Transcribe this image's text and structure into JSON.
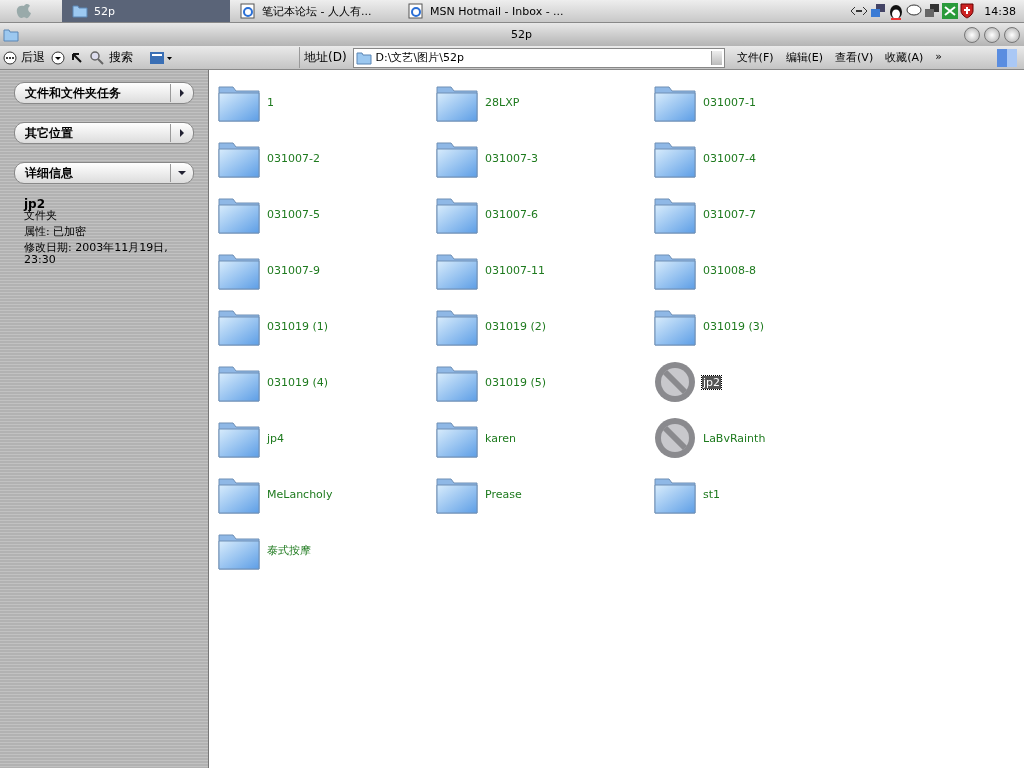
{
  "taskbar": {
    "tasks": [
      {
        "label": "52p",
        "kind": "folder",
        "selected": true
      },
      {
        "label": "笔记本论坛 - 人人有...",
        "kind": "browser",
        "selected": false
      },
      {
        "label": "MSN Hotmail - Inbox - ...",
        "kind": "browser",
        "selected": false
      }
    ],
    "clock": "14:38"
  },
  "window": {
    "title": "52p"
  },
  "toolbar": {
    "back": "后退",
    "search": "搜索",
    "address_label": "地址(D)",
    "address": "D:\\文艺\\图片\\52p",
    "menus": [
      "文件(F)",
      "编辑(E)",
      "查看(V)",
      "收藏(A)"
    ],
    "more": "»"
  },
  "sidebar": {
    "panels": [
      {
        "title": "文件和文件夹任务",
        "expanded": false
      },
      {
        "title": "其它位置",
        "expanded": false
      },
      {
        "title": "详细信息",
        "expanded": true
      }
    ],
    "details": {
      "name": "jp2",
      "type": "文件夹",
      "attributes": "属性: 已加密",
      "modified": "修改日期: 2003年11月19日, 23:30"
    }
  },
  "items": [
    {
      "name": "1",
      "kind": "folder",
      "selected": false
    },
    {
      "name": "28LXP",
      "kind": "folder",
      "selected": false
    },
    {
      "name": "031007-1",
      "kind": "folder",
      "selected": false
    },
    {
      "name": "031007-2",
      "kind": "folder",
      "selected": false
    },
    {
      "name": "031007-3",
      "kind": "folder",
      "selected": false
    },
    {
      "name": "031007-4",
      "kind": "folder",
      "selected": false
    },
    {
      "name": "031007-5",
      "kind": "folder",
      "selected": false
    },
    {
      "name": "031007-6",
      "kind": "folder",
      "selected": false
    },
    {
      "name": "031007-7",
      "kind": "folder",
      "selected": false
    },
    {
      "name": "031007-9",
      "kind": "folder",
      "selected": false
    },
    {
      "name": "031007-11",
      "kind": "folder",
      "selected": false
    },
    {
      "name": "031008-8",
      "kind": "folder",
      "selected": false
    },
    {
      "name": "031019 (1)",
      "kind": "folder",
      "selected": false
    },
    {
      "name": "031019 (2)",
      "kind": "folder",
      "selected": false
    },
    {
      "name": "031019 (3)",
      "kind": "folder",
      "selected": false
    },
    {
      "name": "031019 (4)",
      "kind": "folder",
      "selected": false
    },
    {
      "name": "031019 (5)",
      "kind": "folder",
      "selected": false
    },
    {
      "name": "jp2",
      "kind": "blocked",
      "selected": true
    },
    {
      "name": "jp4",
      "kind": "folder",
      "selected": false
    },
    {
      "name": "karen",
      "kind": "folder",
      "selected": false
    },
    {
      "name": "LaBvRainth",
      "kind": "blocked",
      "selected": false
    },
    {
      "name": "MeLancholy",
      "kind": "folder",
      "selected": false
    },
    {
      "name": "Prease",
      "kind": "folder",
      "selected": false
    },
    {
      "name": "st1",
      "kind": "folder",
      "selected": false
    },
    {
      "name": "泰式按摩",
      "kind": "folder",
      "selected": false
    }
  ]
}
